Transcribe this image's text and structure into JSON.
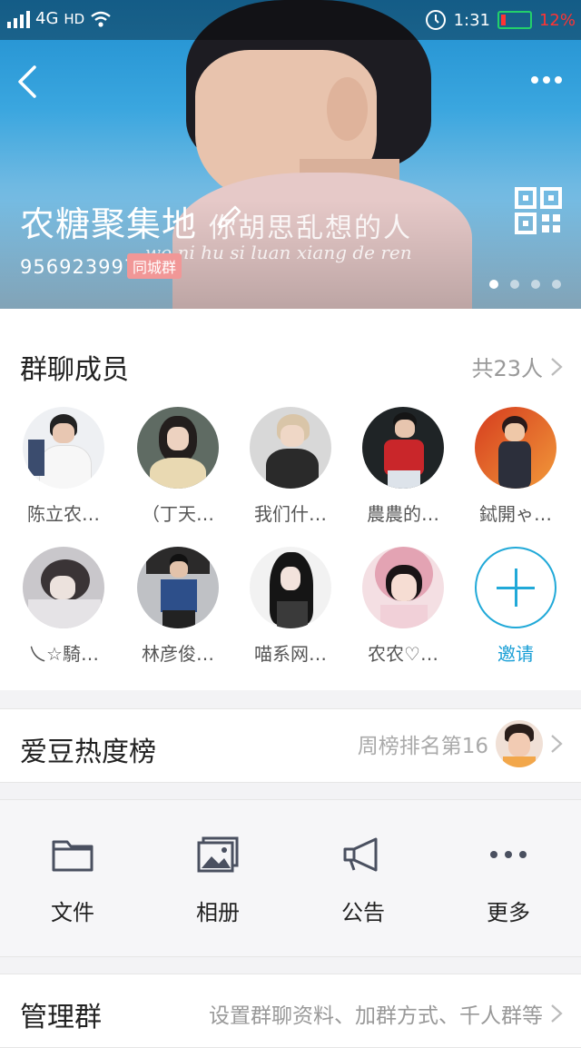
{
  "status_bar": {
    "network": "4G",
    "hd": "HD",
    "time": "1:31",
    "battery": "12%"
  },
  "header": {
    "group_name": "农糖聚集地",
    "group_id": "956923997",
    "badge": "同城群",
    "photo_caption": "你胡思乱想的人",
    "photo_caption_pinyin": "wo ni hu si luan xiang de ren",
    "carousel_pages": 4,
    "carousel_active": 1
  },
  "members": {
    "title": "群聊成员",
    "count_label": "共23人",
    "list": [
      {
        "name": "陈立农…",
        "avatar": "avatar-photo"
      },
      {
        "name": "（丁天…",
        "avatar": "avatar-photo"
      },
      {
        "name": "我们什…",
        "avatar": "avatar-photo"
      },
      {
        "name": "農農的…",
        "avatar": "avatar-photo"
      },
      {
        "name": "鋱開ゃ…",
        "avatar": "avatar-photo"
      },
      {
        "name": "乀☆騎…",
        "avatar": "avatar-photo"
      },
      {
        "name": "林彦俊…",
        "avatar": "avatar-photo"
      },
      {
        "name": "喵系网…",
        "avatar": "avatar-photo"
      },
      {
        "name": "农农♡…",
        "avatar": "avatar-photo"
      }
    ],
    "invite_label": "邀请"
  },
  "idol_rank": {
    "title": "爱豆热度榜",
    "value": "周榜排名第16"
  },
  "tools": [
    {
      "label": "文件",
      "icon": "folder-icon"
    },
    {
      "label": "相册",
      "icon": "photo-album-icon"
    },
    {
      "label": "公告",
      "icon": "megaphone-icon"
    },
    {
      "label": "更多",
      "icon": "more-dots-icon"
    }
  ],
  "manage": {
    "title": "管理群",
    "value": "设置群聊资料、加群方式、千人群等"
  },
  "colors": {
    "accent": "#1a9fd6",
    "badge": "#f19797",
    "battery_low": "#ff3333"
  }
}
